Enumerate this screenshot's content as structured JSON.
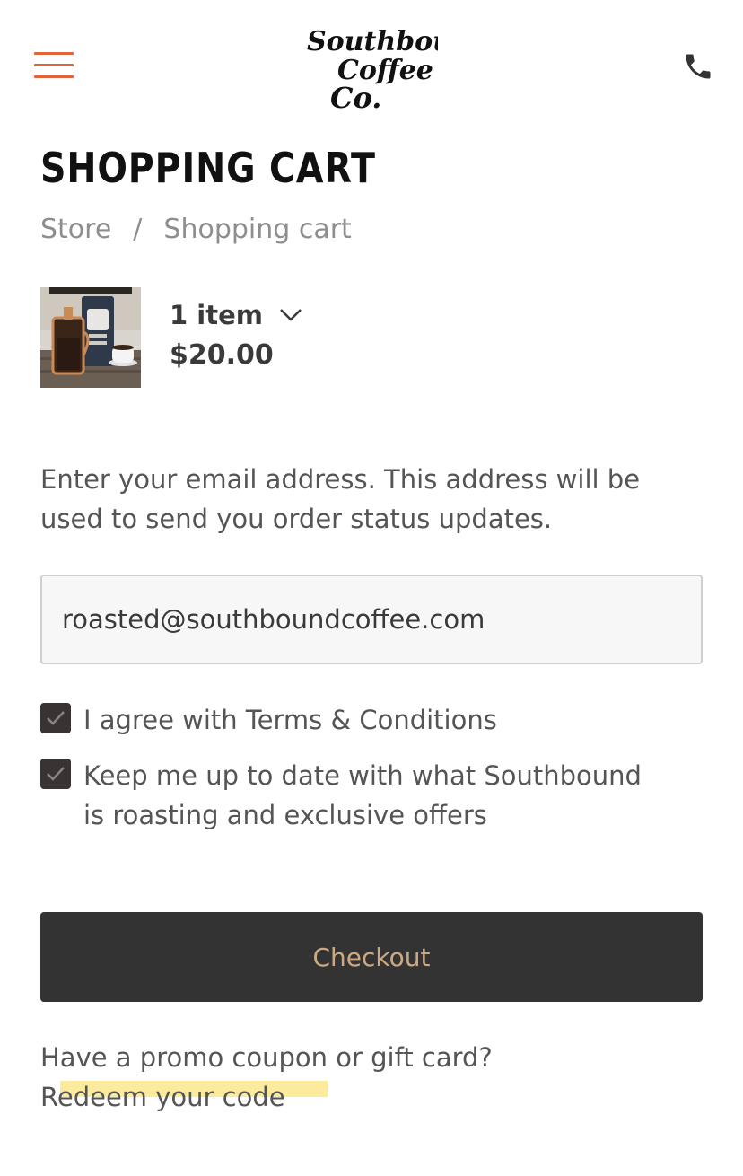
{
  "header": {
    "logo_lines": [
      "Southbound",
      "Coffee",
      "Co."
    ],
    "menu_icon": "hamburger-menu-icon",
    "phone_icon": "phone-icon",
    "accent_color": "#e0653a"
  },
  "page": {
    "title": "SHOPPING CART",
    "breadcrumb": {
      "store": "Store",
      "separator": "/",
      "current": "Shopping cart"
    }
  },
  "cart": {
    "item_count": "1 item",
    "total": "$20.00",
    "chevron_icon": "chevron-down-icon"
  },
  "email": {
    "description": "Enter your email address. This address will be used to send you order status updates.",
    "value": "roasted@southboundcoffee.com"
  },
  "agreements": {
    "terms_label": "I agree with Terms & Conditions",
    "terms_checked": true,
    "newsletter_label": "Keep me up to date with what Southbound is roasting and exclusive offers",
    "newsletter_checked": true
  },
  "checkout": {
    "label": "Checkout",
    "button_color": "#333333",
    "text_color": "#cda981"
  },
  "promo": {
    "question": "Have a promo coupon or gift card?",
    "link": "Redeem your code"
  }
}
